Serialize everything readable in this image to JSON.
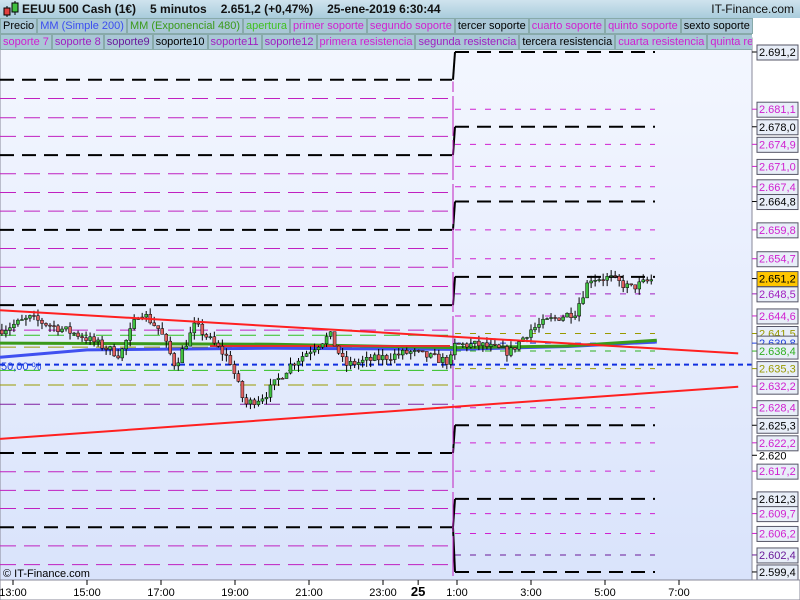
{
  "header": {
    "title": "EEUU 500 Cash (1€)",
    "timeframe": "5 minutos",
    "price": "2.651,2 (+0,47%)",
    "datetime": "25-ene-2019 6:30:44",
    "brand": "IT-Finance.com"
  },
  "legend_row1": [
    {
      "label": "Precio",
      "color": "#000000"
    },
    {
      "label": "MM (Simple 200)",
      "color": "#3b4df0"
    },
    {
      "label": "MM (Exponencial 480)",
      "color": "#3a9a1a"
    },
    {
      "label": "apertura",
      "color": "#40c020"
    },
    {
      "label": "primer soporte",
      "color": "#d020d0"
    },
    {
      "label": "segundo soporte",
      "color": "#d020d0"
    },
    {
      "label": "tercer soporte",
      "color": "#000000"
    },
    {
      "label": "cuarto soporte",
      "color": "#d020d0"
    },
    {
      "label": "quinto soporte",
      "color": "#d020d0"
    },
    {
      "label": "sexto soporte",
      "color": "#000000"
    }
  ],
  "legend_row2": [
    {
      "label": "soporte 7",
      "color": "#d020d0"
    },
    {
      "label": "soporte 8",
      "color": "#a020c0"
    },
    {
      "label": "soporte9",
      "color": "#6a1a9a"
    },
    {
      "label": "soporte10",
      "color": "#000000"
    },
    {
      "label": "soporte11",
      "color": "#a020c0"
    },
    {
      "label": "soporte12",
      "color": "#a020c0"
    },
    {
      "label": "primera resistencia",
      "color": "#d020d0"
    },
    {
      "label": "segunda resistencia",
      "color": "#a020c0"
    },
    {
      "label": "tercera resistencia",
      "color": "#000000"
    },
    {
      "label": "cuarta resistencia",
      "color": "#d020d0"
    },
    {
      "label": "quinta resi",
      "color": "#d020d0"
    }
  ],
  "watermark": "© IT-Finance.com",
  "fib_label": "50,00 %",
  "chart_data": {
    "type": "candlestick",
    "title": "EEUU 500 Cash (1€) 5 minutos",
    "ylim": [
      2599.4,
      2691.2
    ],
    "x_ticks": [
      {
        "label": "13:00",
        "t": 13
      },
      {
        "label": "15:00",
        "t": 15
      },
      {
        "label": "17:00",
        "t": 17
      },
      {
        "label": "19:00",
        "t": 19
      },
      {
        "label": "21:00",
        "t": 21
      },
      {
        "label": "23:00",
        "t": 23
      },
      {
        "label": "25",
        "t": 23.95,
        "bold": true
      },
      {
        "label": "1:00",
        "t": 25
      },
      {
        "label": "3:00",
        "t": 27
      },
      {
        "label": "5:00",
        "t": 29
      },
      {
        "label": "7:00",
        "t": 31
      }
    ],
    "y_labels": [
      {
        "v": 2691.2,
        "label": "2.691,2",
        "color": "#000000"
      },
      {
        "v": 2681.1,
        "label": "2.681,1",
        "color": "#d020d0"
      },
      {
        "v": 2678.0,
        "label": "2.678,0",
        "color": "#000000"
      },
      {
        "v": 2674.9,
        "label": "2.674,9",
        "color": "#d020d0"
      },
      {
        "v": 2671.0,
        "label": "2.671,0",
        "color": "#d020d0"
      },
      {
        "v": 2667.4,
        "label": "2.667,4",
        "color": "#d020d0"
      },
      {
        "v": 2664.8,
        "label": "2.664,8",
        "color": "#000000"
      },
      {
        "v": 2659.8,
        "label": "2.659,8",
        "color": "#d020d0"
      },
      {
        "v": 2654.7,
        "label": "2.654,7",
        "color": "#d020d0"
      },
      {
        "v": 2651.2,
        "label": "2.651,2",
        "color": "#000000",
        "current": true
      },
      {
        "v": 2648.5,
        "label": "2.648,5",
        "color": "#a020c0"
      },
      {
        "v": 2644.6,
        "label": "2.644,6",
        "color": "#d020d0"
      },
      {
        "v": 2641.5,
        "label": "2.641,5",
        "color": "#999900"
      },
      {
        "v": 2639.8,
        "label": "2.639,8",
        "color": "#2040e0"
      },
      {
        "v": 2638.4,
        "label": "2.638,4",
        "color": "#30b020"
      },
      {
        "v": 2635.3,
        "label": "2.635,3",
        "color": "#999900"
      },
      {
        "v": 2632.2,
        "label": "2.632,2",
        "color": "#d020d0"
      },
      {
        "v": 2628.4,
        "label": "2.628,4",
        "color": "#d020d0"
      },
      {
        "v": 2625.3,
        "label": "2.625,3",
        "color": "#000000"
      },
      {
        "v": 2622.2,
        "label": "2.622,2",
        "color": "#d020d0"
      },
      {
        "v": 2620.0,
        "label": "2.620",
        "color": "#000000",
        "plain": true
      },
      {
        "v": 2617.2,
        "label": "2.617,2",
        "color": "#d020d0"
      },
      {
        "v": 2612.3,
        "label": "2.612,3",
        "color": "#000000"
      },
      {
        "v": 2609.7,
        "label": "2.609,7",
        "color": "#d020d0"
      },
      {
        "v": 2606.2,
        "label": "2.606,2",
        "color": "#d020d0"
      },
      {
        "v": 2602.4,
        "label": "2.602,4",
        "color": "#6a1a9a"
      },
      {
        "v": 2599.4,
        "label": "2.599,4",
        "color": "#000000"
      }
    ],
    "left_levels": {
      "black": [
        2686.3,
        2673.0,
        2659.8,
        2646.5,
        2620.4,
        2607.3
      ],
      "magenta": [
        2683.0,
        2679.6,
        2676.3,
        2669.7,
        2666.4,
        2663.1,
        2656.5,
        2653.2,
        2649.8,
        2642.1,
        2617.1,
        2613.8,
        2610.6,
        2604.0,
        2600.7
      ],
      "olive": [
        2639.1,
        2632.4
      ],
      "green": [
        2641.2,
        2635.0
      ],
      "magenta2": [
        2629.0
      ]
    },
    "right_black_levels": [
      2691.2,
      2678.0,
      2664.8,
      2651.5,
      2625.3,
      2612.3,
      2599.4
    ],
    "fib_50": 2636.0,
    "trendlines": [
      {
        "from": [
          12.65,
          2645.6
        ],
        "to": [
          32.6,
          2638.0
        ],
        "color": "#ff2020"
      },
      {
        "from": [
          12.65,
          2622.9
        ],
        "to": [
          32.6,
          2632.1
        ],
        "color": "#ff2020"
      }
    ],
    "sma200": [
      [
        12.65,
        2637.3
      ],
      [
        15,
        2638.6
      ],
      [
        20,
        2638.9
      ],
      [
        25,
        2638.7
      ],
      [
        28,
        2639.2
      ],
      [
        30.4,
        2640.0
      ]
    ],
    "ema480": [
      [
        12.65,
        2639.8
      ],
      [
        20,
        2639.6
      ],
      [
        25,
        2639.0
      ],
      [
        28,
        2639.3
      ],
      [
        30.4,
        2640.3
      ]
    ],
    "close_path": [
      [
        12.65,
        2642.1
      ],
      [
        13.46,
        2644.2
      ],
      [
        14.0,
        2643.0
      ],
      [
        14.81,
        2641.2
      ],
      [
        15.35,
        2639.5
      ],
      [
        15.89,
        2637.7
      ],
      [
        16.43,
        2645.6
      ],
      [
        16.97,
        2642.1
      ],
      [
        17.38,
        2635.9
      ],
      [
        17.92,
        2643.0
      ],
      [
        18.46,
        2639.5
      ],
      [
        18.86,
        2636.8
      ],
      [
        19.27,
        2628.9
      ],
      [
        19.81,
        2630.6
      ],
      [
        20.49,
        2635.9
      ],
      [
        21.03,
        2638.6
      ],
      [
        21.57,
        2641.2
      ],
      [
        21.97,
        2635.9
      ],
      [
        22.65,
        2636.8
      ],
      [
        23.73,
        2638.2
      ],
      [
        24.81,
        2636.5
      ],
      [
        24.95,
        2639.5
      ],
      [
        25.62,
        2639.5
      ],
      [
        26.43,
        2638.2
      ],
      [
        26.97,
        2642.1
      ],
      [
        27.51,
        2643.9
      ],
      [
        28.19,
        2645.3
      ],
      [
        28.59,
        2651.3
      ],
      [
        29.14,
        2651.3
      ],
      [
        29.68,
        2649.5
      ],
      [
        30.35,
        2651.2
      ]
    ]
  }
}
